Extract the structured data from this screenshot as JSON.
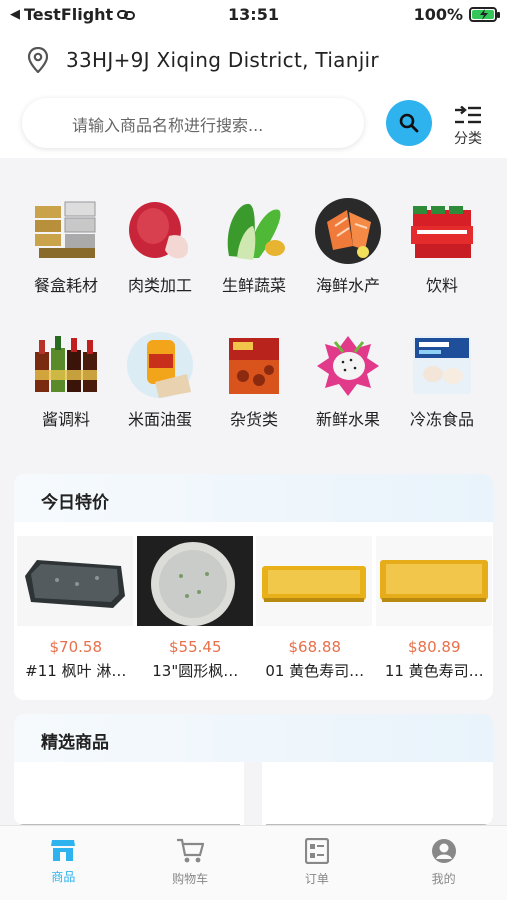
{
  "status": {
    "back_label": "TestFlight",
    "time": "13:51",
    "battery": "100%"
  },
  "location": {
    "text": "33HJ+9J Xiqing District, Tianjir",
    "icon": "location-pin-icon"
  },
  "search": {
    "placeholder": "请输入商品名称进行搜索...",
    "category_label": "分类"
  },
  "categories": [
    {
      "label": "餐盒耗材",
      "icon": "containers-icon"
    },
    {
      "label": "肉类加工",
      "icon": "meat-icon"
    },
    {
      "label": "生鲜蔬菜",
      "icon": "vegetable-icon"
    },
    {
      "label": "海鲜水产",
      "icon": "seafood-icon"
    },
    {
      "label": "饮料",
      "icon": "drinks-icon"
    },
    {
      "label": "酱调料",
      "icon": "sauce-icon"
    },
    {
      "label": "米面油蛋",
      "icon": "oil-rice-icon"
    },
    {
      "label": "杂货类",
      "icon": "grocery-icon"
    },
    {
      "label": "新鲜水果",
      "icon": "fruit-icon"
    },
    {
      "label": "冷冻食品",
      "icon": "frozen-icon"
    }
  ],
  "deals": {
    "title": "今日特价",
    "items": [
      {
        "price": "$70.58",
        "name": "#11 枫叶 淋…"
      },
      {
        "price": "$55.45",
        "name": "13\"圆形枫…"
      },
      {
        "price": "$68.88",
        "name": "01 黄色寿司…"
      },
      {
        "price": "$80.89",
        "name": "11 黄色寿司…"
      }
    ]
  },
  "featured": {
    "title": "精选商品"
  },
  "tabs": [
    {
      "label": "商品",
      "active": true,
      "icon": "store-icon"
    },
    {
      "label": "购物车",
      "active": false,
      "icon": "cart-icon"
    },
    {
      "label": "订单",
      "active": false,
      "icon": "orders-icon"
    },
    {
      "label": "我的",
      "active": false,
      "icon": "profile-icon"
    }
  ],
  "colors": {
    "accent": "#2fb3ef",
    "price": "#e8704b",
    "battery": "#34c759"
  }
}
